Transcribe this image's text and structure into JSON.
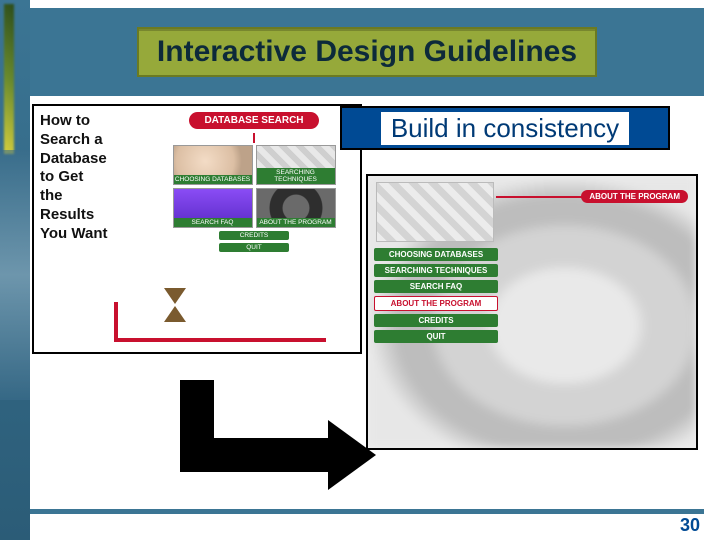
{
  "title": "Interactive Design Guidelines",
  "subtitle": "Build in consistency",
  "page_number": "30",
  "shot1": {
    "howto_lines": [
      "How to",
      "Search a",
      "Database",
      "to Get",
      "the",
      "Results",
      "You Want"
    ],
    "top_pill": "DATABASE SEARCH",
    "thumbs": [
      "CHOOSING DATABASES",
      "SEARCHING TECHNIQUES",
      "SEARCH FAQ",
      "ABOUT THE PROGRAM"
    ],
    "small_pills": [
      "CREDITS",
      "QUIT"
    ]
  },
  "shot2": {
    "top_right_pill": "ABOUT THE PROGRAM",
    "nav": [
      "CHOOSING DATABASES",
      "SEARCHING TECHNIQUES",
      "SEARCH FAQ",
      "ABOUT THE PROGRAM",
      "CREDITS",
      "QUIT"
    ]
  }
}
